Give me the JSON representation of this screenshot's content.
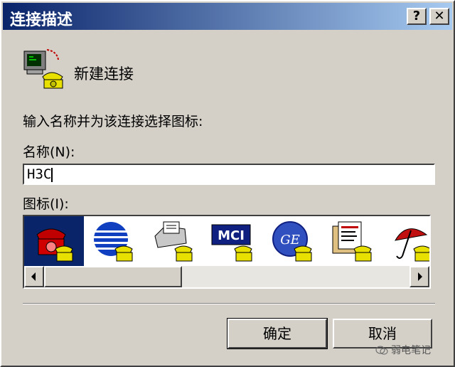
{
  "window": {
    "title": "连接描述",
    "help_label": "?",
    "close_label": "✕"
  },
  "connection": {
    "title": "新建连接",
    "icon": "phone-computer-icon"
  },
  "form": {
    "prompt": "输入名称并为该连接选择图标:",
    "name_label": "名称(N):",
    "name_value": "H3C",
    "icon_label": "图标(I):"
  },
  "icons": [
    {
      "name": "red-phone-icon",
      "selected": true
    },
    {
      "name": "globe-phone-icon"
    },
    {
      "name": "fax-phone-icon"
    },
    {
      "name": "mci-phone-icon",
      "label": "MCI"
    },
    {
      "name": "ge-phone-icon",
      "label": "GE"
    },
    {
      "name": "documents-phone-icon"
    },
    {
      "name": "umbrella-phone-icon"
    }
  ],
  "buttons": {
    "ok": "确定",
    "cancel": "取消"
  },
  "watermark": "弱电笔记",
  "colors": {
    "titlebar": "#0a246a",
    "face": "#d4d0c8",
    "selection": "#0a246a"
  }
}
